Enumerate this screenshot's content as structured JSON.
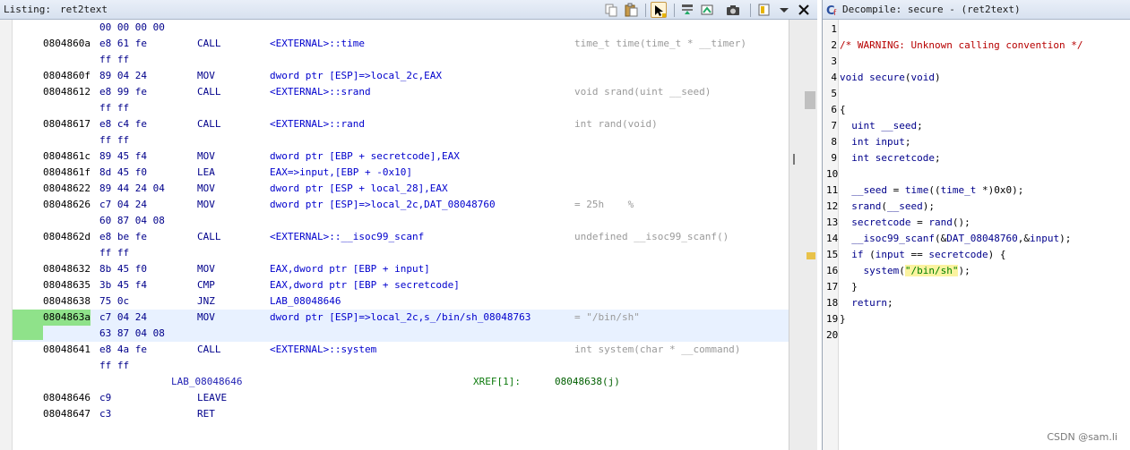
{
  "listing": {
    "title": "Listing:",
    "subtitle": "ret2text",
    "rows": [
      {
        "addr": "",
        "bytes": "00 00 00 00",
        "mnemonic": "",
        "operand": "",
        "comment": ""
      },
      {
        "addr": "0804860a",
        "bytes": "e8 61 fe",
        "mnemonic": "CALL",
        "operand": "<EXTERNAL>::time",
        "comment": "time_t time(time_t * __timer)"
      },
      {
        "addr": "",
        "bytes": "ff ff",
        "mnemonic": "",
        "operand": "",
        "comment": ""
      },
      {
        "addr": "0804860f",
        "bytes": "89 04 24",
        "mnemonic": "MOV",
        "operand": "dword ptr [ESP]=>local_2c,EAX",
        "comment": ""
      },
      {
        "addr": "08048612",
        "bytes": "e8 99 fe",
        "mnemonic": "CALL",
        "operand": "<EXTERNAL>::srand",
        "comment": "void srand(uint __seed)"
      },
      {
        "addr": "",
        "bytes": "ff ff",
        "mnemonic": "",
        "operand": "",
        "comment": ""
      },
      {
        "addr": "08048617",
        "bytes": "e8 c4 fe",
        "mnemonic": "CALL",
        "operand": "<EXTERNAL>::rand",
        "comment": "int rand(void)"
      },
      {
        "addr": "",
        "bytes": "ff ff",
        "mnemonic": "",
        "operand": "",
        "comment": ""
      },
      {
        "addr": "0804861c",
        "bytes": "89 45 f4",
        "mnemonic": "MOV",
        "operand": "dword ptr [EBP + secretcode],EAX",
        "comment": ""
      },
      {
        "addr": "0804861f",
        "bytes": "8d 45 f0",
        "mnemonic": "LEA",
        "operand": "EAX=>input,[EBP + -0x10]",
        "comment": ""
      },
      {
        "addr": "08048622",
        "bytes": "89 44 24 04",
        "mnemonic": "MOV",
        "operand": "dword ptr [ESP + local_28],EAX",
        "comment": ""
      },
      {
        "addr": "08048626",
        "bytes": "c7 04 24",
        "mnemonic": "MOV",
        "operand": "dword ptr [ESP]=>local_2c,DAT_08048760",
        "comment": "= 25h    %"
      },
      {
        "addr": "",
        "bytes": "60 87 04 08",
        "mnemonic": "",
        "operand": "",
        "comment": ""
      },
      {
        "addr": "0804862d",
        "bytes": "e8 be fe",
        "mnemonic": "CALL",
        "operand": "<EXTERNAL>::__isoc99_scanf",
        "comment": "undefined __isoc99_scanf()"
      },
      {
        "addr": "",
        "bytes": "ff ff",
        "mnemonic": "",
        "operand": "",
        "comment": ""
      },
      {
        "addr": "08048632",
        "bytes": "8b 45 f0",
        "mnemonic": "MOV",
        "operand": "EAX,dword ptr [EBP + input]",
        "comment": ""
      },
      {
        "addr": "08048635",
        "bytes": "3b 45 f4",
        "mnemonic": "CMP",
        "operand": "EAX,dword ptr [EBP + secretcode]",
        "comment": ""
      },
      {
        "addr": "08048638",
        "bytes": "75 0c",
        "mnemonic": "JNZ",
        "operand": "LAB_08048646",
        "comment": ""
      },
      {
        "addr": "0804863a",
        "bytes": "c7 04 24",
        "mnemonic": "MOV",
        "operand": "dword ptr [ESP]=>local_2c,s_/bin/sh_08048763",
        "comment": "= \"/bin/sh\""
      },
      {
        "addr": "",
        "bytes": "63 87 04 08",
        "mnemonic": "",
        "operand": "",
        "comment": ""
      },
      {
        "addr": "08048641",
        "bytes": "e8 4a fe",
        "mnemonic": "CALL",
        "operand": "<EXTERNAL>::system",
        "comment": "int system(char * __command)"
      },
      {
        "addr": "",
        "bytes": "ff ff",
        "mnemonic": "",
        "operand": "",
        "comment": ""
      },
      {
        "addr": "",
        "bytes": "",
        "mnemonic": "",
        "operand": "",
        "comment": ""
      },
      {
        "addr": "08048646",
        "bytes": "c9",
        "mnemonic": "LEAVE",
        "operand": "",
        "comment": ""
      },
      {
        "addr": "08048647",
        "bytes": "c3",
        "mnemonic": "RET",
        "operand": "",
        "comment": ""
      }
    ],
    "label_row": {
      "name": "LAB_08048646",
      "xref": "XREF[1]:",
      "xref_value": "08048638(j)"
    }
  },
  "decompile": {
    "title": "Decompile: secure -  (ret2text)",
    "lines": [
      {
        "n": "1",
        "text": ""
      },
      {
        "n": "2",
        "text": "/* WARNING: Unknown calling convention */"
      },
      {
        "n": "3",
        "text": ""
      },
      {
        "n": "4",
        "text": "void secure(void)"
      },
      {
        "n": "5",
        "text": ""
      },
      {
        "n": "6",
        "text": "{"
      },
      {
        "n": "7",
        "text": "  uint __seed;"
      },
      {
        "n": "8",
        "text": "  int input;"
      },
      {
        "n": "9",
        "text": "  int secretcode;"
      },
      {
        "n": "10",
        "text": ""
      },
      {
        "n": "11",
        "text": "  __seed = time((time_t *)0x0);"
      },
      {
        "n": "12",
        "text": "  srand(__seed);"
      },
      {
        "n": "13",
        "text": "  secretcode = rand();"
      },
      {
        "n": "14",
        "text": "  __isoc99_scanf(&DAT_08048760,&input);"
      },
      {
        "n": "15",
        "text": "  if (input == secretcode) {"
      },
      {
        "n": "16",
        "text": "    system(\"/bin/sh\");"
      },
      {
        "n": "17",
        "text": "  }"
      },
      {
        "n": "18",
        "text": "  return;"
      },
      {
        "n": "19",
        "text": "}"
      },
      {
        "n": "20",
        "text": ""
      }
    ]
  },
  "watermark": "CSDN @sam.li",
  "icons": [
    "copy-icon",
    "paste-icon",
    "cursor-select-icon",
    "flow-arrow-icon",
    "snapshot-icon",
    "camera-icon",
    "display-options-icon",
    "dropdown-icon",
    "close-icon",
    "decompile-icon"
  ]
}
